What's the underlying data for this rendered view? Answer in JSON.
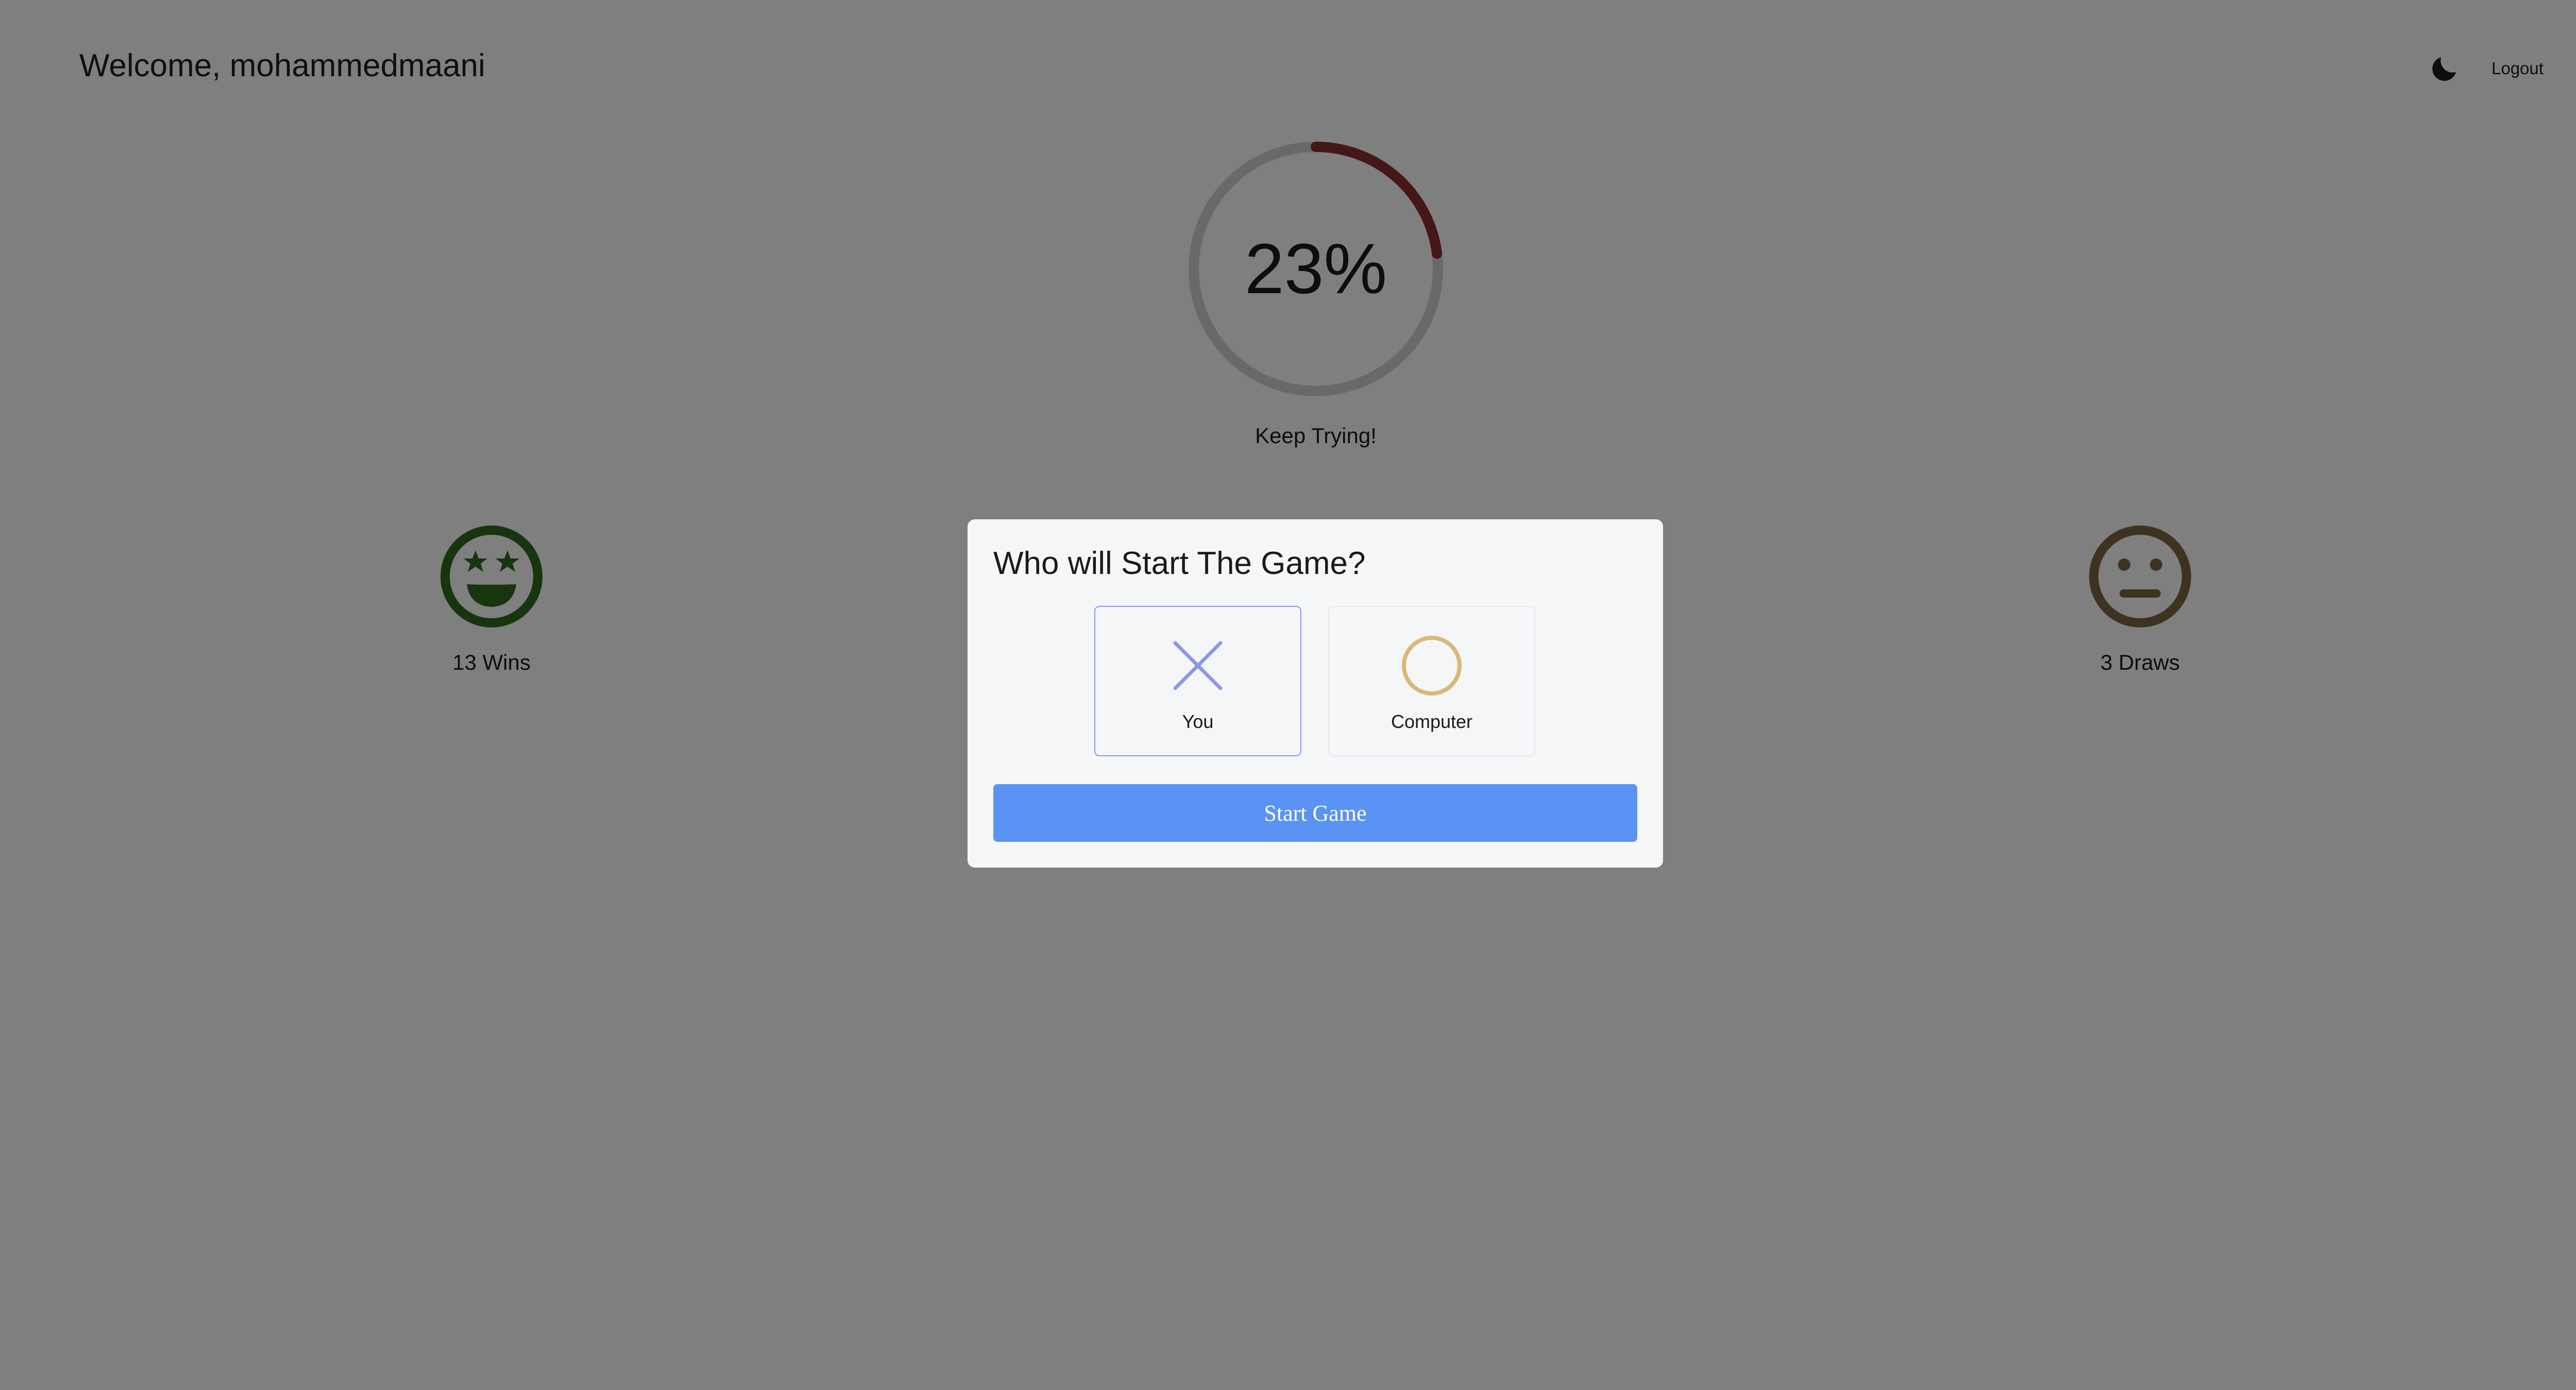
{
  "header": {
    "welcome_text": "Welcome, mohammedmaani",
    "logout_label": "Logout",
    "theme_icon": "moon-icon"
  },
  "progress": {
    "percent_text": "23%",
    "value": 0.23,
    "message": "Keep Trying!",
    "ring_color": "#8b2f2f",
    "track_color": "#d3d3d3"
  },
  "stats": {
    "wins": {
      "label": "13 Wins",
      "icon": "star-eyes-face-icon",
      "color": "#2f6b1e"
    },
    "draws": {
      "label": "3 Draws",
      "icon": "neutral-face-icon",
      "color": "#7d6640"
    }
  },
  "modal": {
    "close_icon": "close-icon",
    "title": "Who will Start The Game?",
    "choices": [
      {
        "label": "You",
        "icon": "x-mark-icon",
        "color": "#8d97e9",
        "selected": true
      },
      {
        "label": "Computer",
        "icon": "circle-o-icon",
        "color": "#d9b97a",
        "selected": false
      }
    ],
    "start_label": "Start Game",
    "start_color": "#5b93f5"
  }
}
